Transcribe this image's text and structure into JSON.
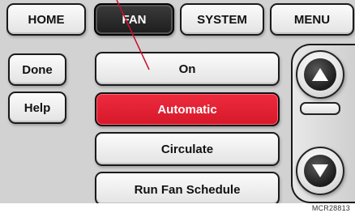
{
  "tabs": [
    {
      "label": "HOME",
      "active": false
    },
    {
      "label": "FAN",
      "active": true
    },
    {
      "label": "SYSTEM",
      "active": false
    },
    {
      "label": "MENU",
      "active": false
    }
  ],
  "side_buttons": {
    "done": "Done",
    "help": "Help"
  },
  "fan_options": [
    {
      "label": "On",
      "selected": false
    },
    {
      "label": "Automatic",
      "selected": true
    },
    {
      "label": "Circulate",
      "selected": false
    },
    {
      "label": "Run Fan Schedule",
      "selected": false
    }
  ],
  "scroll": {
    "up_icon": "triangle-up-icon",
    "down_icon": "triangle-down-icon"
  },
  "figure_ref": "MCR28813",
  "colors": {
    "selected": "#e01f33",
    "active_tab": "#2a2a2a",
    "background": "#d2d2d2",
    "pointer_line": "#c8102e"
  }
}
